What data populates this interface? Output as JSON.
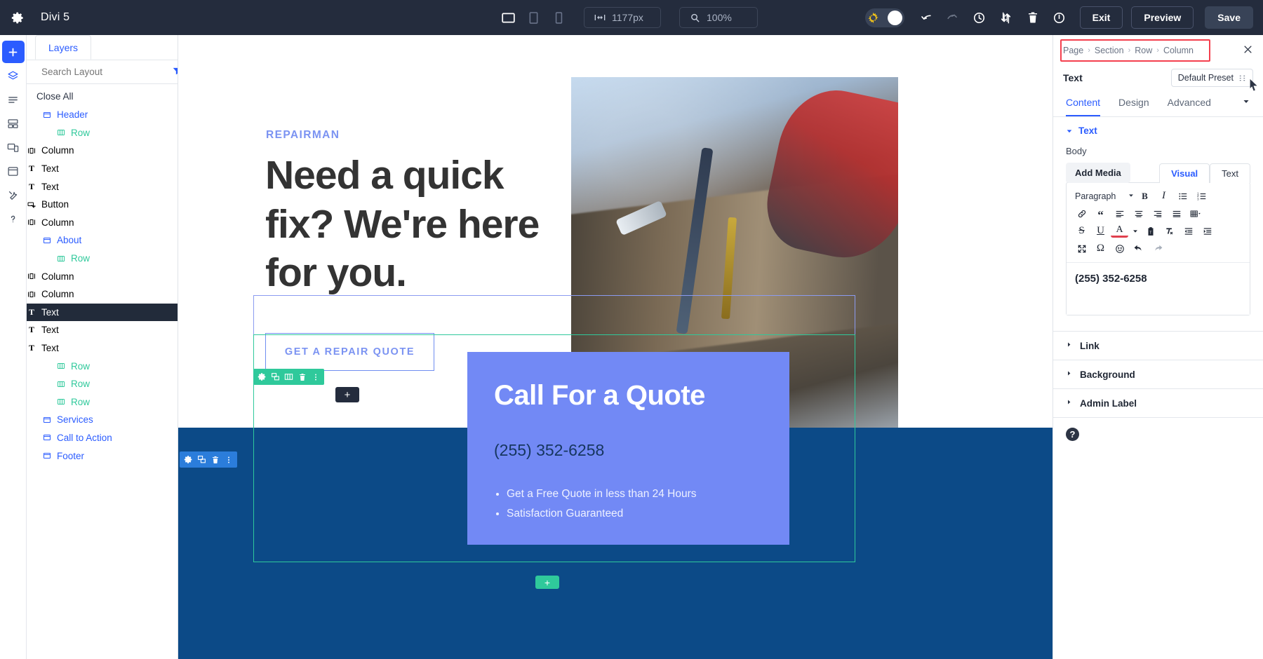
{
  "topbar": {
    "gear_icon": "gear-icon",
    "app_title": "Divi 5",
    "viewports": [
      {
        "name": "desktop",
        "icon": "desktop-icon",
        "active": true
      },
      {
        "name": "tablet",
        "icon": "tablet-icon",
        "active": false
      },
      {
        "name": "phone",
        "icon": "phone-icon",
        "active": false
      }
    ],
    "width_value": "1177px",
    "width_icon": "resize-horizontal-icon",
    "zoom_value": "100%",
    "zoom_icon": "magnifier-icon",
    "toggle_icon": "sun-gear-icon",
    "icons": [
      "undo-icon",
      "redo-icon",
      "history-clock-icon",
      "sort-arrows-icon",
      "trash-icon",
      "power-icon"
    ],
    "exit_label": "Exit",
    "preview_label": "Preview",
    "save_label": "Save"
  },
  "rail": {
    "items": [
      {
        "name": "add-module",
        "icon": "plus-icon",
        "primary": true
      },
      {
        "name": "layers",
        "icon": "layers-icon",
        "primary": false
      },
      {
        "name": "list-view",
        "icon": "list-icon",
        "primary": false
      },
      {
        "name": "wireframe",
        "icon": "wireframe-icon",
        "primary": false
      },
      {
        "name": "responsive",
        "icon": "responsive-icon",
        "primary": false
      },
      {
        "name": "history",
        "icon": "history-icon",
        "primary": false
      },
      {
        "name": "tools",
        "icon": "tools-icon",
        "primary": false
      },
      {
        "name": "help",
        "icon": "question-icon",
        "primary": false
      }
    ]
  },
  "layers_panel": {
    "tab_label": "Layers",
    "search_placeholder": "Search Layout",
    "search_value": "",
    "search_icon": "search-icon",
    "filter_icon": "filter-icon",
    "close_all_label": "Close All",
    "tree": [
      {
        "label": "Header",
        "level": "section",
        "icon": "section-icon",
        "selected": false
      },
      {
        "label": "Row",
        "level": "row",
        "icon": "row-icon",
        "selected": false
      },
      {
        "label": "Column",
        "level": "column",
        "icon": "column-icon",
        "selected": false
      },
      {
        "label": "Text",
        "level": "module",
        "icon": "text-icon",
        "selected": false
      },
      {
        "label": "Text",
        "level": "module",
        "icon": "text-icon",
        "selected": false
      },
      {
        "label": "Button",
        "level": "module",
        "icon": "button-icon",
        "selected": false
      },
      {
        "label": "Column",
        "level": "column",
        "icon": "column-icon",
        "selected": false
      },
      {
        "label": "About",
        "level": "section",
        "icon": "section-icon",
        "selected": false
      },
      {
        "label": "Row",
        "level": "row",
        "icon": "row-icon",
        "selected": false
      },
      {
        "label": "Column",
        "level": "column",
        "icon": "column-icon",
        "selected": false
      },
      {
        "label": "Column",
        "level": "column",
        "icon": "column-icon",
        "selected": false
      },
      {
        "label": "Text",
        "level": "module",
        "icon": "text-icon",
        "selected": true
      },
      {
        "label": "Text",
        "level": "module",
        "icon": "text-icon",
        "selected": false
      },
      {
        "label": "Text",
        "level": "module",
        "icon": "text-icon",
        "selected": false
      },
      {
        "label": "Row",
        "level": "row",
        "icon": "row-icon",
        "selected": false
      },
      {
        "label": "Row",
        "level": "row",
        "icon": "row-icon",
        "selected": false
      },
      {
        "label": "Row",
        "level": "row",
        "icon": "row-icon",
        "selected": false
      },
      {
        "label": "Services",
        "level": "section",
        "icon": "section-icon",
        "selected": false
      },
      {
        "label": "Call to Action",
        "level": "section",
        "icon": "section-icon",
        "selected": false
      },
      {
        "label": "Footer",
        "level": "section",
        "icon": "section-icon",
        "selected": false
      }
    ]
  },
  "canvas": {
    "hero": {
      "eyebrow": "REPAIRMAN",
      "title": "Need a quick fix? We're here for you.",
      "cta_label": "GET A REPAIR QUOTE"
    },
    "quote_card": {
      "title": "Call For a Quote",
      "phone": "(255) 352-6258",
      "bullets": [
        "Get a Free Quote in less than 24 Hours",
        "Satisfaction Guaranteed"
      ],
      "bg_color": "#7289f5"
    },
    "section_bg_color": "#0c4a87",
    "row_outline_color": "#2fc99b",
    "column_outline_color": "#8b9bf0",
    "green_toolbar_icons": [
      "gear-icon",
      "duplicate-icon",
      "columns-icon",
      "trash-icon",
      "more-vertical-icon"
    ],
    "blue_toolbar_icons": [
      "gear-icon",
      "duplicate-icon",
      "trash-icon",
      "more-vertical-icon"
    ],
    "add_module_label": "+",
    "add_row_label": "+"
  },
  "settings_panel": {
    "breadcrumb": [
      "Page",
      "Section",
      "Row",
      "Column"
    ],
    "breadcrumb_highlight_color": "#f4404e",
    "close_icon": "close-icon",
    "module_name": "Text",
    "preset_label": "Default Preset",
    "preset_icon": "preset-icon",
    "tabs": [
      {
        "label": "Content",
        "active": true
      },
      {
        "label": "Design",
        "active": false
      },
      {
        "label": "Advanced",
        "active": false
      }
    ],
    "tabs_caret_icon": "chevron-down-icon",
    "cursor_icon": "cursor-arrow-icon",
    "open_group": {
      "label": "Text",
      "caret_icon": "caret-down-icon",
      "field_label": "Body",
      "add_media_label": "Add Media",
      "editor_tabs": [
        {
          "label": "Visual",
          "active": true
        },
        {
          "label": "Text",
          "active": false
        }
      ],
      "format_select_value": "Paragraph",
      "toolbar_rows": [
        [
          "format-select",
          "bold-icon",
          "italic-icon",
          "bulleted-list-icon",
          "numbered-list-icon"
        ],
        [
          "link-icon",
          "blockquote-icon",
          "align-left-icon",
          "align-center-icon",
          "align-right-icon",
          "align-justify-icon",
          "table-icon"
        ],
        [
          "strikethrough-icon",
          "underline-icon",
          "text-color-icon",
          "paste-as-text-icon",
          "clear-formatting-icon",
          "outdent-icon",
          "indent-icon"
        ],
        [
          "fullscreen-icon",
          "special-character-icon",
          "emoji-icon",
          "undo-icon",
          "redo-icon"
        ]
      ],
      "body_value": "(255) 352-6258"
    },
    "closed_groups": [
      {
        "label": "Link",
        "caret_icon": "caret-right-icon"
      },
      {
        "label": "Background",
        "caret_icon": "caret-right-icon"
      },
      {
        "label": "Admin Label",
        "caret_icon": "caret-right-icon"
      }
    ],
    "help_icon": "help-icon"
  }
}
